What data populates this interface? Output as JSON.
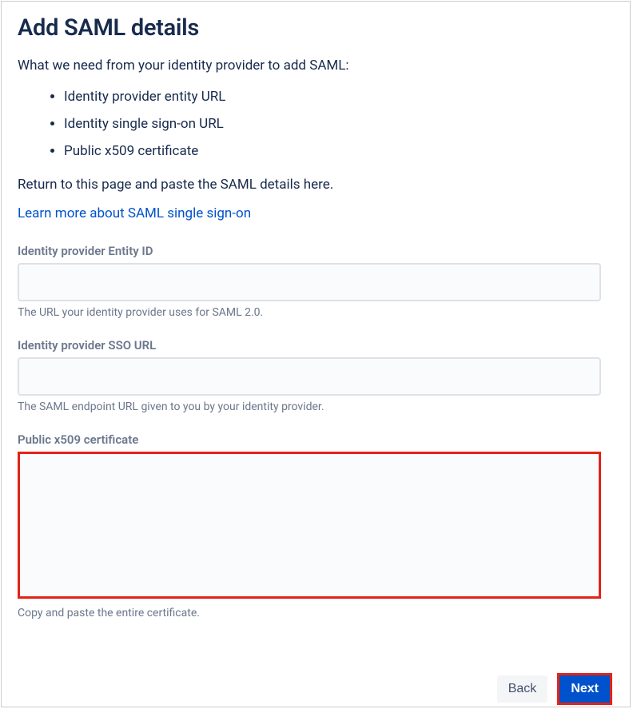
{
  "header": {
    "title": "Add SAML details"
  },
  "intro": "What we need from your identity provider to add SAML:",
  "requirements": [
    "Identity provider entity URL",
    "Identity single sign-on URL",
    "Public x509 certificate"
  ],
  "return_text": "Return to this page and paste the SAML details here.",
  "learn_more_link": "Learn more about SAML single sign-on",
  "fields": {
    "entity_id": {
      "label": "Identity provider Entity ID",
      "value": "",
      "help": "The URL your identity provider uses for SAML 2.0."
    },
    "sso_url": {
      "label": "Identity provider SSO URL",
      "value": "",
      "help": "The SAML endpoint URL given to you by your identity provider."
    },
    "certificate": {
      "label": "Public x509 certificate",
      "value": "",
      "help": "Copy and paste the entire certificate."
    }
  },
  "buttons": {
    "back": "Back",
    "next": "Next"
  }
}
